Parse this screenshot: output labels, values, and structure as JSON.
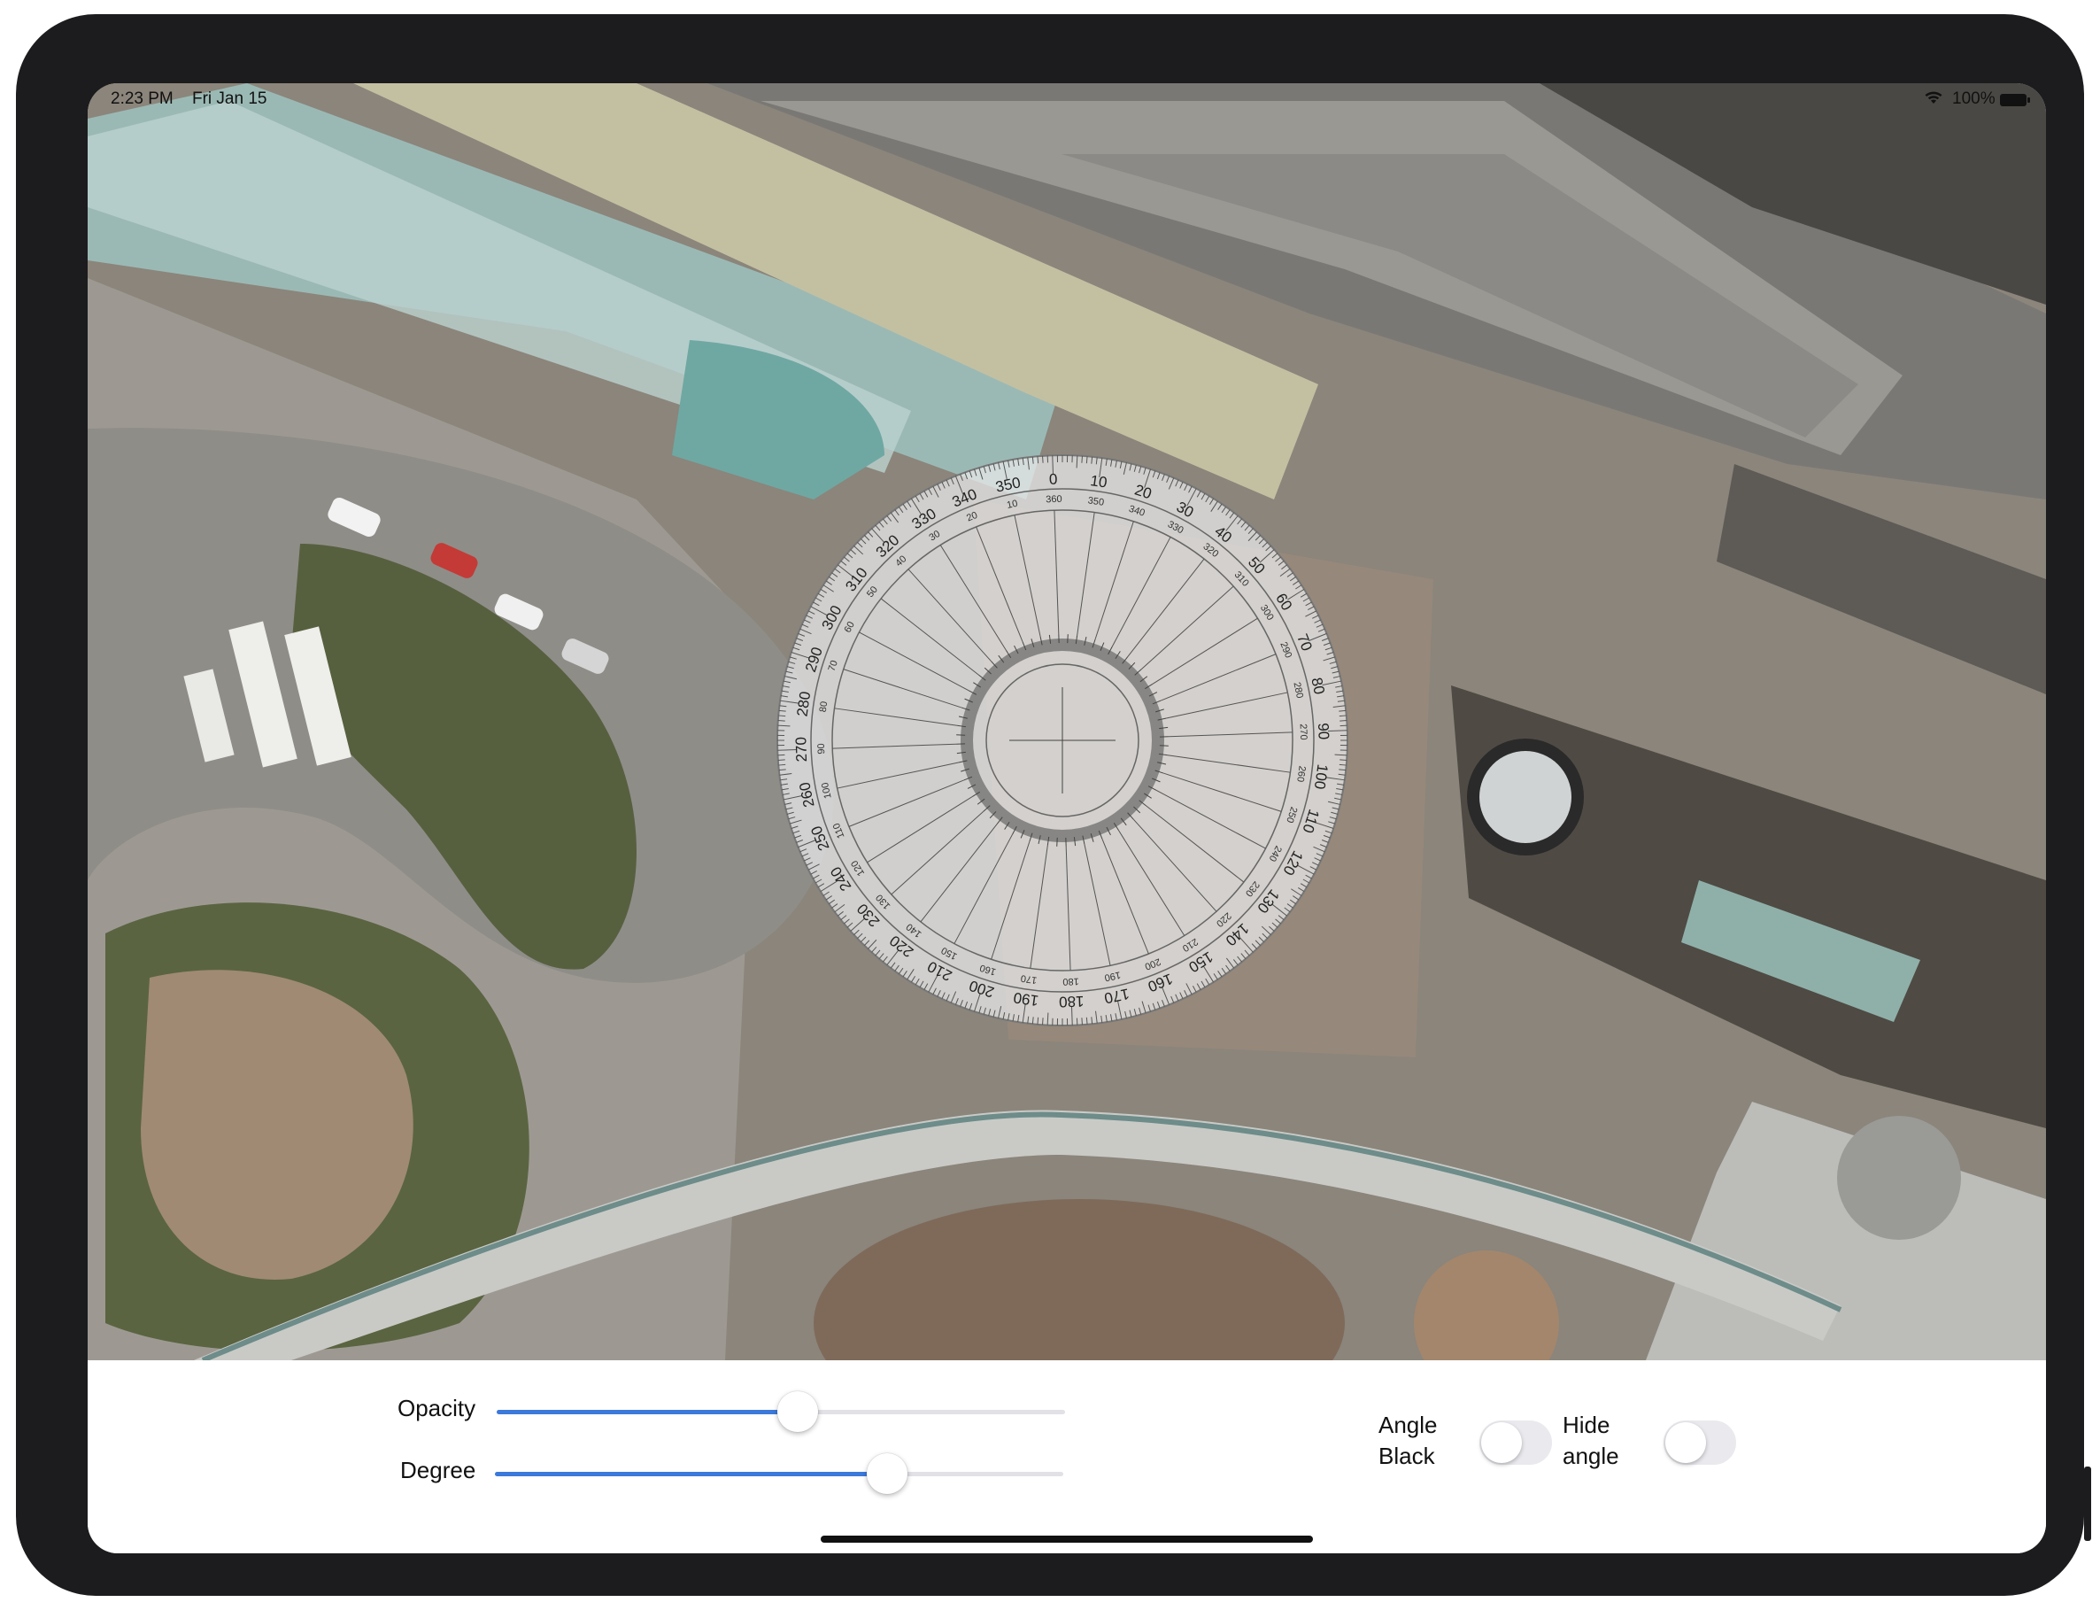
{
  "status_bar": {
    "time": "2:23 PM",
    "date": "Fri Jan 15",
    "battery": "100%"
  },
  "colors": {
    "slider_fill": "#3b79db",
    "device_frame": "#1c1c1e"
  },
  "controls": {
    "opacity": {
      "label": "Opacity",
      "value": 0.53
    },
    "degree": {
      "label": "Degree",
      "value": 0.69
    },
    "angle_black": {
      "label_line1": "Angle",
      "label_line2": "Black",
      "on": false
    },
    "hide_angle": {
      "label_line1": "Hide",
      "label_line2": "angle",
      "on": false
    }
  },
  "protractor": {
    "outer_labels": [
      "0",
      "10",
      "20",
      "30",
      "40",
      "50",
      "60",
      "70",
      "80",
      "90",
      "100",
      "110",
      "120",
      "130",
      "140",
      "150",
      "160",
      "170",
      "180",
      "190",
      "200",
      "210",
      "220",
      "230",
      "240",
      "250",
      "260",
      "270",
      "280",
      "290",
      "300",
      "310",
      "320",
      "330",
      "340",
      "350"
    ],
    "inner_labels": [
      "360",
      "350",
      "340",
      "330",
      "320",
      "310",
      "300",
      "290",
      "280",
      "270",
      "260",
      "250",
      "240",
      "230",
      "220",
      "210",
      "200",
      "190",
      "180",
      "170",
      "160",
      "150",
      "140",
      "130",
      "120",
      "110",
      "100",
      "90",
      "80",
      "70",
      "60",
      "50",
      "40",
      "30",
      "20",
      "10"
    ]
  },
  "icons": [
    "wifi-icon",
    "battery-icon"
  ]
}
